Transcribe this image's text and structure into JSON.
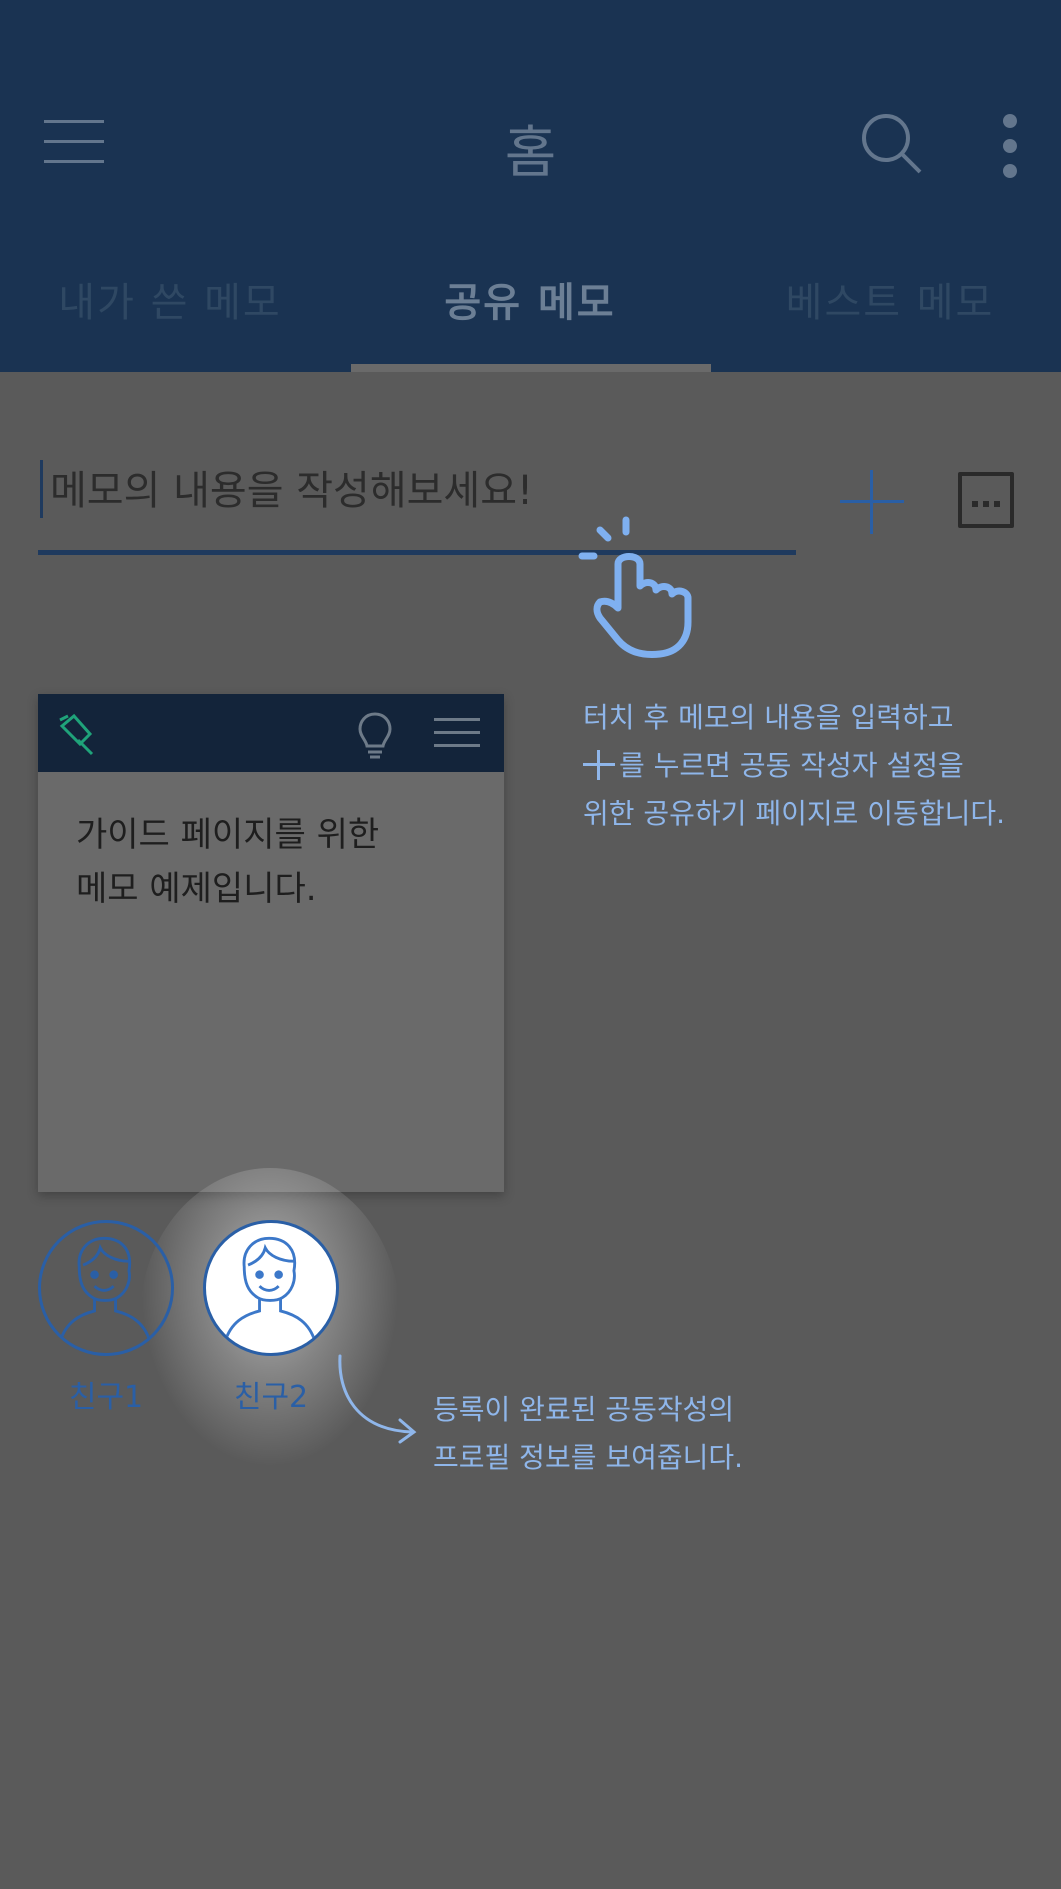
{
  "appbar": {
    "title": "홈",
    "tabs": [
      {
        "label": "내가 쓴 메모",
        "selected": false
      },
      {
        "label": "공유 메모",
        "selected": true
      },
      {
        "label": "베스트 메모",
        "selected": false
      }
    ],
    "icons": [
      "menu-icon",
      "search-icon",
      "more-vert-icon"
    ]
  },
  "memo_input": {
    "placeholder": "메모의 내용을 작성해보세요!",
    "add_icon": "plus-icon",
    "more_icon": "dots-box-icon"
  },
  "guides": {
    "input_guide": {
      "line1": "터치 후 메모의 내용을 입력하고",
      "line2": "를 누르면 공동 작성자 설정을",
      "line3": "위한 공유하기 페이지로 이동합니다."
    },
    "friends_guide": {
      "line1": "등록이 완료된 공동작성의",
      "line2": "프로필 정보를 보여줍니다."
    }
  },
  "memo_card": {
    "text": "가이드 페이지를 위한\n메모 예제입니다.",
    "icons": [
      "pin-icon",
      "bulb-icon",
      "menu-icon"
    ]
  },
  "friends": [
    {
      "name": "친구1",
      "highlighted": false
    },
    {
      "name": "친구2",
      "highlighted": true
    }
  ],
  "colors": {
    "appbar": "#1a3352",
    "overlay_bg": "#5a5a5a",
    "accent": "#2a5fa6",
    "guide_text": "#8fb6ea",
    "pin_green": "#1fa37a"
  }
}
